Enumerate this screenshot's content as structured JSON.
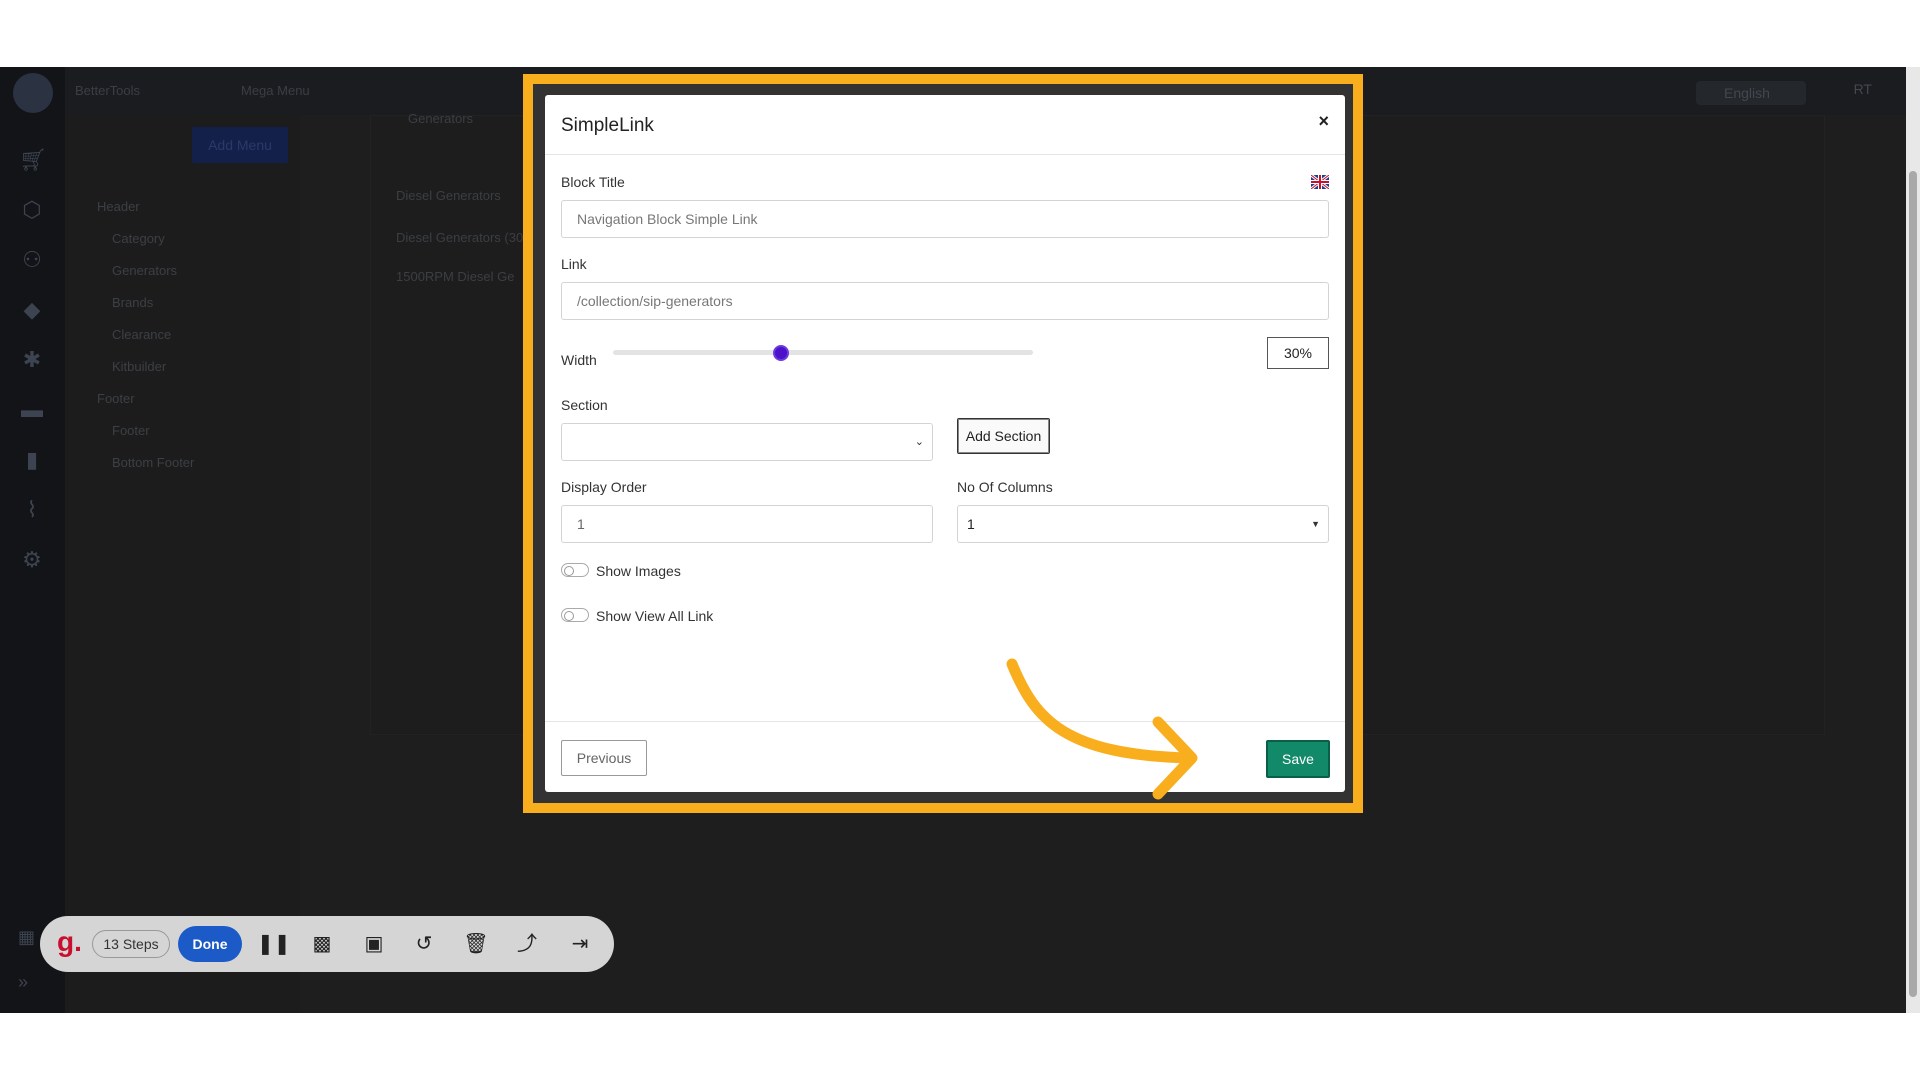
{
  "topbar": {
    "org": "BetterTools",
    "page": "Mega Menu",
    "language": "English",
    "user_initials": "RT"
  },
  "sidebar": {
    "add_menu_label": "Add Menu",
    "tree": [
      {
        "label": "Header"
      },
      {
        "label": "Category"
      },
      {
        "label": "Generators"
      },
      {
        "label": "Brands"
      },
      {
        "label": "Clearance"
      },
      {
        "label": "Kitbuilder"
      },
      {
        "label": "Footer"
      },
      {
        "label": "Footer"
      },
      {
        "label": "Bottom Footer"
      }
    ]
  },
  "background": {
    "tab": "Generators",
    "row1": "Diesel Generators",
    "row2": "Diesel Generators (30",
    "row3": "1500RPM Diesel Ge"
  },
  "modal": {
    "title": "SimpleLink",
    "close": "×",
    "block_title_label": "Block Title",
    "block_title_value": "Navigation Block Simple Link",
    "link_label": "Link",
    "link_value": "/collection/sip-generators",
    "width_label": "Width",
    "width_value": "30%",
    "width_percent": 30,
    "section_label": "Section",
    "section_value": "",
    "add_section_label": "Add Section",
    "display_order_label": "Display Order",
    "display_order_value": "1",
    "columns_label": "No Of Columns",
    "columns_value": "1",
    "show_images_label": "Show Images",
    "show_images_on": false,
    "show_view_all_label": "Show View All Link",
    "show_view_all_on": false,
    "previous_label": "Previous",
    "save_label": "Save"
  },
  "guide_toolbar": {
    "logo": "g.",
    "steps_label": "13 Steps",
    "done_label": "Done"
  },
  "colors": {
    "highlight": "#f9ae1e",
    "save": "#128a6a",
    "slider": "#4b12c9",
    "done": "#1c5bc7"
  }
}
